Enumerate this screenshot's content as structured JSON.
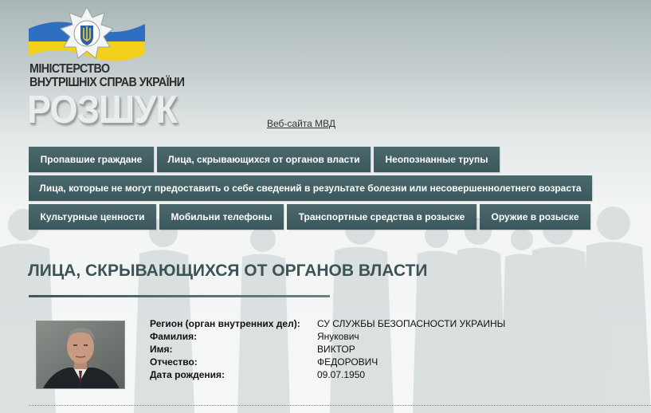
{
  "header": {
    "ministry_line1": "МІНІСТЕРСТВО",
    "ministry_line2": "ВНУТРІШНІХ СПРАВ УКРАЇНИ",
    "site_title": "РОЗШУК",
    "mvd_link": "Веб-сайта МВД"
  },
  "nav": {
    "items": [
      {
        "label": "Пропавшие граждане"
      },
      {
        "label": "Лица, скрывающихся от органов власти"
      },
      {
        "label": "Неопознанные трупы"
      },
      {
        "label": "Лица, которые не могут предоставить о себе сведений в результате болезни или несовершеннолетнего возраста"
      },
      {
        "label": "Культурные ценности"
      },
      {
        "label": "Мобильни телефоны"
      },
      {
        "label": "Транспортные средства в розыске"
      },
      {
        "label": "Оружие в розыске"
      }
    ]
  },
  "main": {
    "title": "ЛИЦА, СКРЫВАЮЩИХСЯ ОТ ОРГАНОВ ВЛАСТИ"
  },
  "record": {
    "region_label": "Регион (орган внутренних дел):",
    "region_value": "СУ СЛУЖБЫ БЕЗОПАСНОСТИ УКРАИНЫ",
    "surname_label": "Фамилия:",
    "surname_value": "Янукович",
    "name_label": "Имя:",
    "name_value": "ВИКТОР",
    "patronymic_label": "Отчество:",
    "patronymic_value": "ФЕДОРОВИЧ",
    "dob_label": "Дата рождения:",
    "dob_value": "09.07.1950"
  },
  "colors": {
    "nav_bg": "#4c6a6e",
    "title": "#3c5358",
    "flag_blue": "#2f6fc2",
    "flag_yellow": "#f2d01c"
  }
}
